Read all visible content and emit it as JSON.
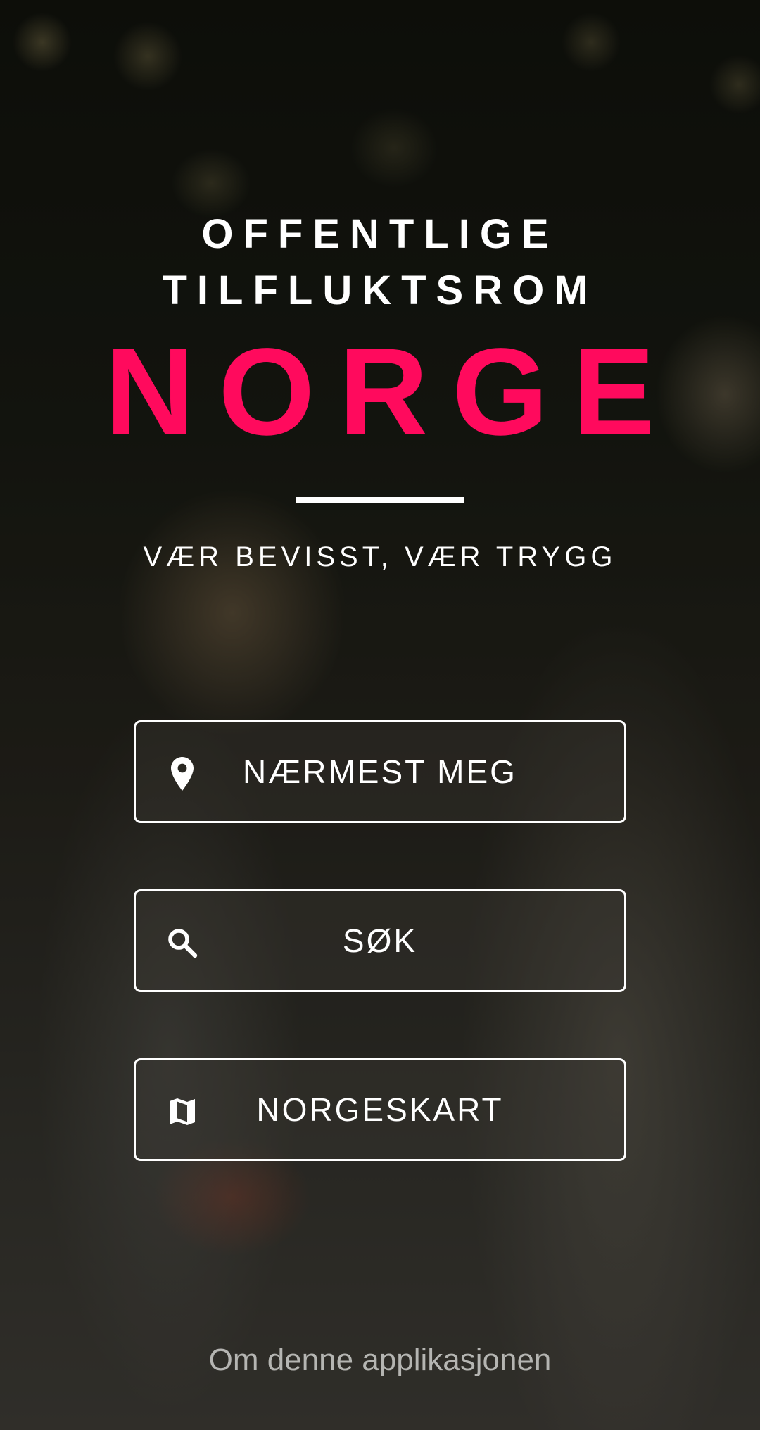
{
  "theme": {
    "accent": "#ff0a5d",
    "text": "#ffffff",
    "muted_text": "#b5b5b2"
  },
  "header": {
    "title_line_1": "OFFENTLIGE",
    "title_line_2": "TILFLUKTSROM",
    "brand": "NORGE",
    "tagline": "VÆR BEVISST, VÆR TRYGG"
  },
  "menu": {
    "nearest": {
      "label": "NÆRMEST MEG",
      "icon": "location-pin-icon"
    },
    "search": {
      "label": "SØK",
      "icon": "search-icon"
    },
    "map": {
      "label": "NORGESKART",
      "icon": "map-icon"
    }
  },
  "footer": {
    "about_link": "Om denne applikasjonen"
  }
}
